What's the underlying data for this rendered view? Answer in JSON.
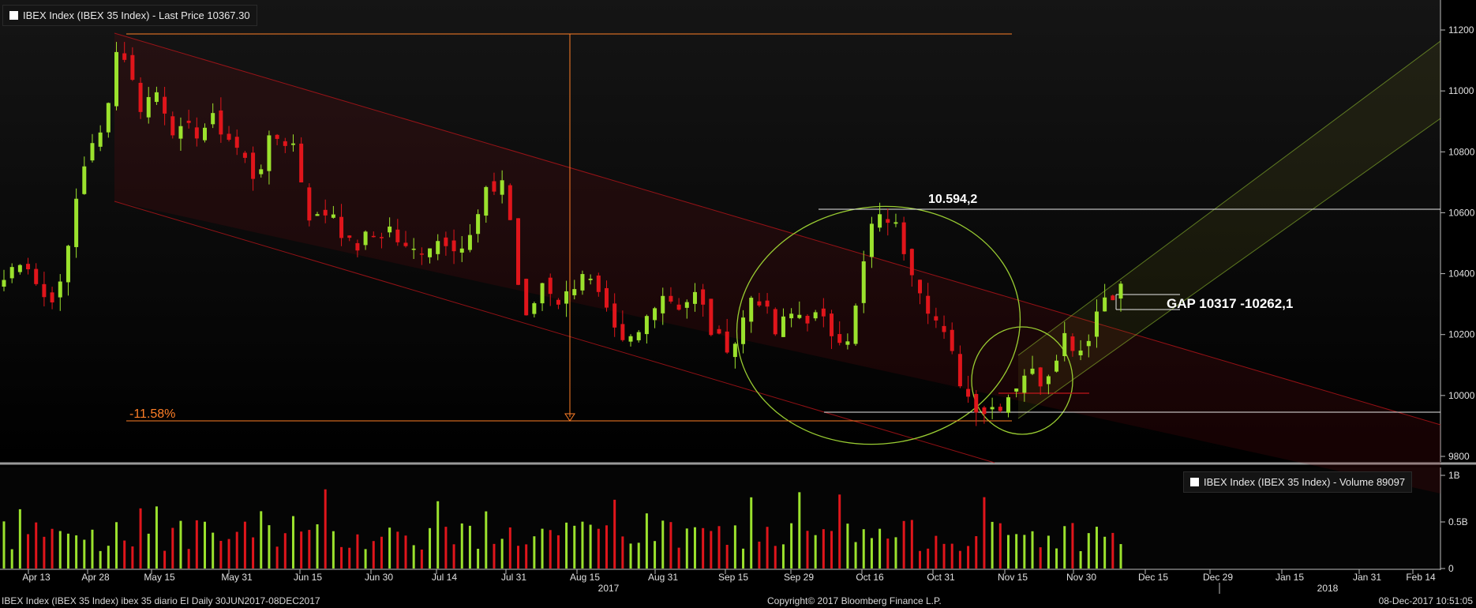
{
  "price_legend": {
    "label": "IBEX Index (IBEX 35 Index) - Last Price 10367.30"
  },
  "volume_legend": {
    "label": "IBEX Index (IBEX 35 Index) - Volume 89097"
  },
  "annotations": {
    "high_label": "10.594,2",
    "gap_label": "GAP 10317 -10262,1",
    "drop_label": "-11.58%"
  },
  "footer": {
    "left": "IBEX Index (IBEX 35 Index) ibex 35 diario EI  Daily 30JUN2017-08DEC2017",
    "center": "Copyright© 2017 Bloomberg Finance L.P.",
    "right": "08-Dec-2017 10:51:05"
  },
  "colors": {
    "up": "#9be22d",
    "down": "#e0151b",
    "channel": "#c0161b",
    "ellipse": "#9acd32",
    "orange": "#ff7f27"
  },
  "chart_data": {
    "type": "candlestick",
    "price_axis": {
      "min": 9720,
      "max": 11220,
      "ticks": [
        9800,
        10000,
        10200,
        10400,
        10600,
        10800,
        11000,
        11200
      ]
    },
    "volume_axis": {
      "max": 1.1,
      "ticks": [
        {
          "v": 0,
          "label": "0"
        },
        {
          "v": 0.5,
          "label": "0.5B"
        },
        {
          "v": 1.0,
          "label": "1B"
        }
      ]
    },
    "x_ticks": [
      "Apr 13",
      "Apr 28",
      "May 15",
      "May 31",
      "Jun 15",
      "Jun 30",
      "Jul 14",
      "Jul 31",
      "Aug 15",
      "Aug 31",
      "Sep 15",
      "Sep 29",
      "Oct 16",
      "Oct 31",
      "Nov 15",
      "Nov 30",
      "Dec 15",
      "Dec 29",
      "Jan 15",
      "Jan 31",
      "Feb 14"
    ],
    "year_labels": [
      "2017",
      "2018"
    ],
    "close_waypoints": [
      10380,
      10470,
      10320,
      10350,
      10750,
      10850,
      11180,
      10950,
      11000,
      10850,
      10870,
      10900,
      10820,
      10720,
      10850,
      10830,
      10560,
      10620,
      10480,
      10520,
      10550,
      10460,
      10500,
      10520,
      10480,
      10650,
      10720,
      10220,
      10380,
      10300,
      10420,
      10300,
      10150,
      10200,
      10350,
      10300,
      10330,
      10170,
      10180,
      10360,
      10200,
      10270,
      10260,
      10210,
      10200,
      10550,
      10590,
      10450,
      10300,
      10160,
      10000,
      9950,
      9990,
      10080,
      10050,
      10200,
      10150,
      10320,
      10367
    ],
    "volume_note": "daily volume bars in billions, approx 0.15-0.95B"
  }
}
